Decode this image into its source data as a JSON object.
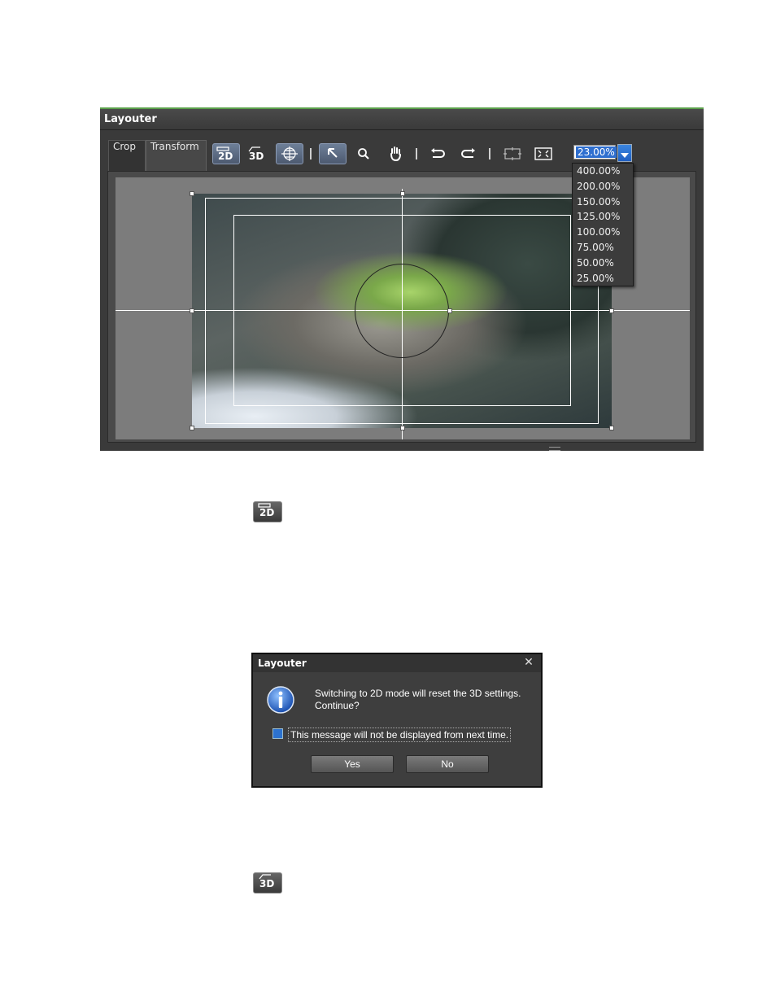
{
  "layouter": {
    "title": "Layouter",
    "tabs": [
      {
        "label": "Crop"
      },
      {
        "label": "Transform"
      }
    ],
    "toolbar": {
      "icons": [
        "2d-mode-icon",
        "3d-mode-icon",
        "grid-icon",
        "select-arrow-icon",
        "zoom-icon",
        "hand-icon",
        "undo-icon",
        "redo-icon",
        "fit-icon",
        "fullscreen-icon"
      ],
      "zoom_value": "23.00%",
      "zoom_options": [
        "400.00%",
        "200.00%",
        "150.00%",
        "125.00%",
        "100.00%",
        "75.00%",
        "50.00%",
        "25.00%"
      ]
    },
    "colors": {
      "accent": "#5aa04a",
      "selection": "#2f6fcf"
    }
  },
  "inline_icons": [
    {
      "name": "2d-mode-icon"
    },
    {
      "name": "3d-mode-icon"
    }
  ],
  "dialog": {
    "title": "Layouter",
    "message": "Switching to 2D mode will reset the 3D settings.\nContinue?",
    "checkbox_label": "This message will not be displayed from next time.",
    "buttons": {
      "yes": "Yes",
      "no": "No"
    }
  }
}
